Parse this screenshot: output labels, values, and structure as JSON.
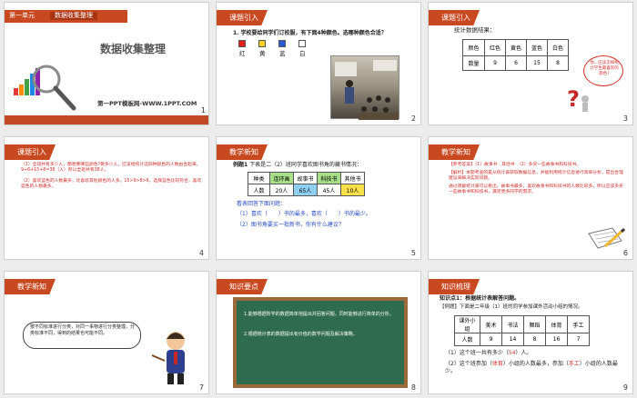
{
  "slides": [
    {
      "number": "1",
      "tab1": "第一单元",
      "tab2": "数据收集整理",
      "title": "数据收集整理",
      "footer": "第一PPT模板网-WWW.1PPT.COM"
    },
    {
      "number": "2",
      "header": "课题引入",
      "question": "1. 学校要给同学们订校服，有下面4种颜色。选哪种颜色合适？",
      "colors": [
        {
          "label": "红",
          "hex": "#e81c1c"
        },
        {
          "label": "黄",
          "hex": "#f3d21a"
        },
        {
          "label": "蓝",
          "hex": "#2c59d6"
        },
        {
          "label": "白",
          "hex": "#ffffff"
        }
      ]
    },
    {
      "number": "3",
      "header": "课题引入",
      "subtitle": "统计数据结果：",
      "table_header": [
        "颜色",
        "红色",
        "黄色",
        "蓝色",
        "白色"
      ],
      "table_row": [
        "数量",
        "9",
        "6",
        "15",
        "8"
      ],
      "bubble": "你，应该怎样统计学生最喜欢的颜色?"
    },
    {
      "number": "4",
      "header": "课题引入",
      "p1": "（1）全班共有多少人，都想要哪些颜色?要多少人，应该给统计这四种颜色的人数由合起来。9+6+15+8=38（人）所以全班共有38人。",
      "p2": "（2）喜欢蓝色的人数最多，比喜欢其他颜色的人多。15>9>8>6，选择蓝色比较符合，喜欢蓝色的人数最多。"
    },
    {
      "number": "5",
      "header": "教学新知",
      "example_lead": "例题1",
      "example_text": "下表是二（2）班同学喜欢图书角的藏书情况：",
      "table_header": [
        "种类",
        "连环画",
        "故事书",
        "科技书",
        "其他书"
      ],
      "table_row": [
        "人数",
        "20人",
        "65人",
        "45人",
        "10人"
      ],
      "prompt": "看表回答下面问题：",
      "q1": "（1）喜欢（　　）书的最多，喜欢（　　）书的最少。",
      "q2": "（2）图书角要买一批新书，你有什么建议？"
    },
    {
      "number": "6",
      "header": "教学新知",
      "p1": "【参考答案】（1）故事书　其他书　（2）多买一些故事书和科技书。",
      "p2": "【解析】本题考查的是从统计表获取数据信息，并能利用统计信息进行简单分析，提出合理建议来解决实际问题。",
      "p3": "通过观察统计表可以看出，故事书最多，喜欢故事书和科技书的人数比较多，所以应该多买一些故事书和科技书，满足更多同学的需求。"
    },
    {
      "number": "7",
      "header": "教学新知",
      "bubble": "按不同标准进行分类，对同一事物进行分类整理，分类标准不同，得到的结果也可能不同。"
    },
    {
      "number": "8",
      "header": "知识要点",
      "b1": "1.能够根据所学的数据简单地提出并回答问题，同时能够进行简单的分析。",
      "b2": "2.根据统计表的数据提出有价值的数学问题及解决策略。"
    },
    {
      "number": "9",
      "header": "知识梳理",
      "intro": "知识点1：根据统计表解答问题。",
      "example": "【例题】下面是二年级（1）班的同学参加课外活动小组的情况。",
      "table_header": [
        "课外小组",
        "美术",
        "书法",
        "舞蹈",
        "体育",
        "手工"
      ],
      "table_row": [
        "人数",
        "9",
        "14",
        "8",
        "16",
        "7"
      ],
      "q1a": "（1）这个班一共有多少（",
      "q1ans": "54",
      "q1b": "）人。",
      "q2a": "（2）这个班参加（",
      "q2ans1": "体育",
      "q2b": "）小组的人数最多，参加（",
      "q2ans2": "手工",
      "q2c": "）小组的人数最少。"
    }
  ]
}
